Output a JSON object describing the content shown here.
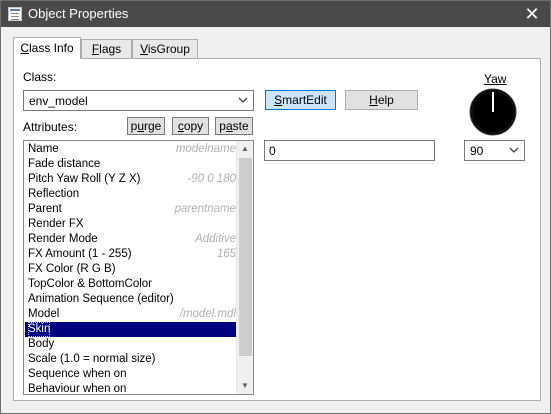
{
  "window": {
    "title": "Object Properties",
    "close_label": "✕"
  },
  "tabs": [
    {
      "label": "Class Info",
      "mnemonic": "C",
      "rest": "lass Info",
      "active": true
    },
    {
      "label": "Flags",
      "mnemonic": "F",
      "rest": "lags",
      "active": false
    },
    {
      "label": "VisGroup",
      "mnemonic": "V",
      "rest": "isGroup",
      "active": false
    }
  ],
  "class_section": {
    "label": "Class:",
    "selected_class": "env_model"
  },
  "buttons": {
    "smartedit": {
      "mnemonic": "S",
      "rest": "martEdit"
    },
    "help": {
      "mnemonic": "H",
      "rest": "elp"
    },
    "purge": {
      "pre": "p",
      "mnemonic": "u",
      "rest": "rge"
    },
    "copy": {
      "mnemonic": "c",
      "rest": "opy"
    },
    "paste": {
      "pre": "p",
      "mnemonic": "a",
      "rest": "ste"
    }
  },
  "attributes_label": "Attributes:",
  "yaw": {
    "label": "Yaw",
    "value": "90"
  },
  "value_field": "0",
  "attributes": [
    {
      "name": "Name",
      "value": "modelname"
    },
    {
      "name": "Fade distance",
      "value": ""
    },
    {
      "name": "Pitch Yaw Roll (Y Z X)",
      "value": "-90 0 180"
    },
    {
      "name": "Reflection",
      "value": ""
    },
    {
      "name": "Parent",
      "value": "parentname"
    },
    {
      "name": "Render FX",
      "value": ""
    },
    {
      "name": "Render Mode",
      "value": "Additive"
    },
    {
      "name": "FX Amount (1 - 255)",
      "value": "165"
    },
    {
      "name": "FX Color (R G B)",
      "value": ""
    },
    {
      "name": "TopColor & BottomColor",
      "value": ""
    },
    {
      "name": "Animation Sequence (editor)",
      "value": ""
    },
    {
      "name": "Model",
      "value": "/model.mdl"
    },
    {
      "name": "Skin",
      "value": "",
      "selected": true
    },
    {
      "name": "Body",
      "value": ""
    },
    {
      "name": "Scale (1.0 = normal size)",
      "value": ""
    },
    {
      "name": "Sequence when on",
      "value": ""
    },
    {
      "name": "Behaviour when on",
      "value": ""
    }
  ],
  "colors": {
    "titlebar": "#4a4a4a",
    "selection": "#000080",
    "smartedit_button": "#cce4f7",
    "smartedit_border": "#0078d7"
  }
}
